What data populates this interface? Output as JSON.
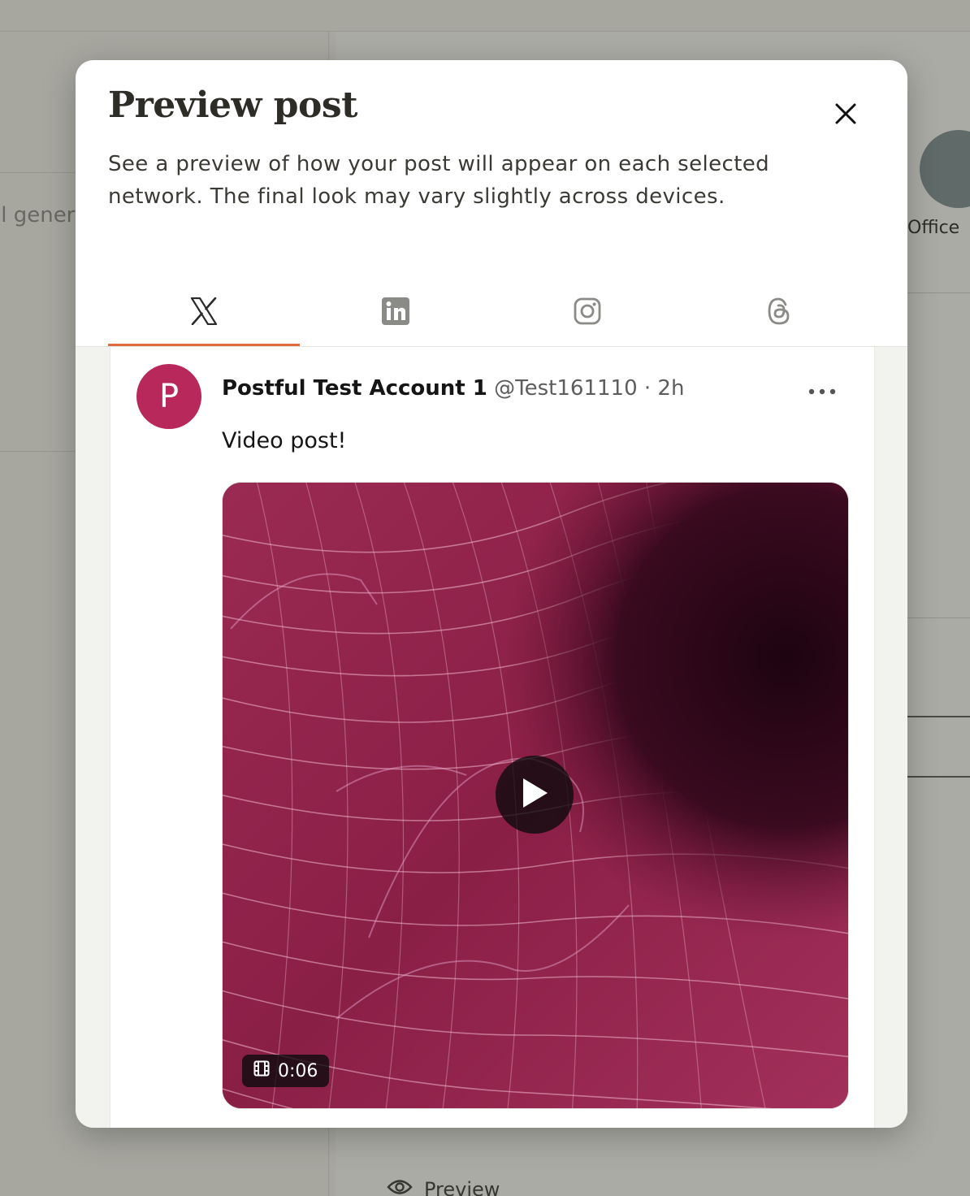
{
  "background": {
    "left_text": "ll gener",
    "avatar_label": "Office",
    "preview_button_label": "Preview"
  },
  "modal": {
    "title": "Preview post",
    "description": "See a preview of how your post will appear on each selected network. The final look may vary slightly across devices.",
    "tabs": [
      {
        "icon": "x-logo-icon",
        "active": true
      },
      {
        "icon": "linkedin-icon",
        "active": false
      },
      {
        "icon": "instagram-icon",
        "active": false
      },
      {
        "icon": "threads-icon",
        "active": false
      }
    ],
    "accent_color": "#e06a3f"
  },
  "tweet": {
    "avatar_letter": "P",
    "avatar_color": "#b8285b",
    "name": "Postful Test Account 1",
    "handle_time": "@Test161110 · 2h",
    "text": "Video post!",
    "video_duration": "0:06"
  }
}
